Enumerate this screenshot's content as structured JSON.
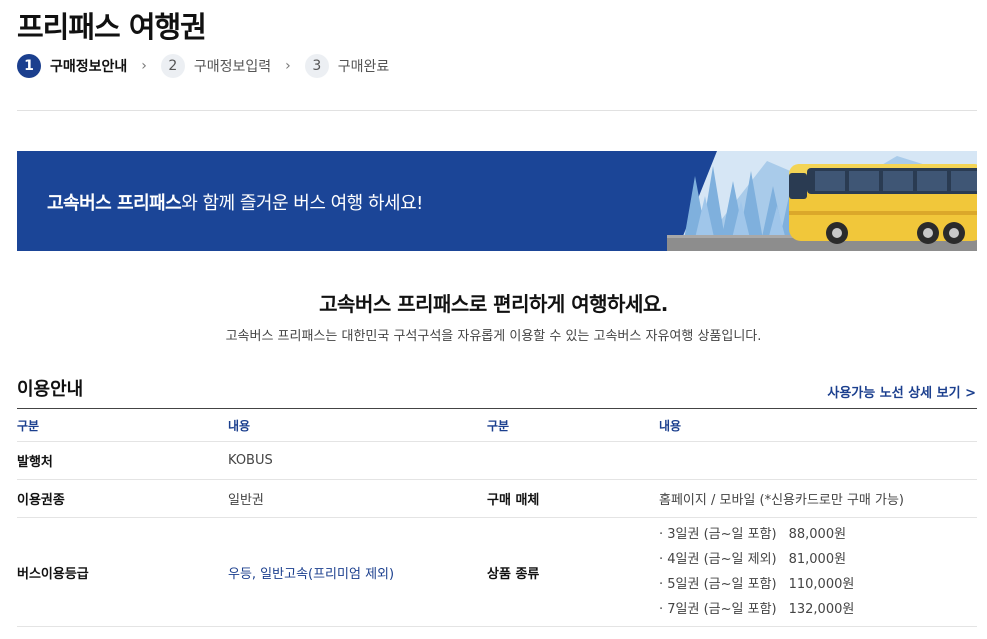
{
  "page": {
    "title": "프리패스 여행권"
  },
  "steps": [
    {
      "num": "1",
      "label": "구매정보안내",
      "active": true
    },
    {
      "num": "2",
      "label": "구매정보입력",
      "active": false
    },
    {
      "num": "3",
      "label": "구매완료",
      "active": false
    }
  ],
  "banner": {
    "highlight": "고속버스 프리패스",
    "text": "와 함께 즐거운 버스 여행 하세요!"
  },
  "intro": {
    "title": "고속버스 프리패스로 편리하게 여행하세요.",
    "desc": "고속버스 프리패스는 대한민국 구석구석을 자유롭게 이용할 수 있는 고속버스 자유여행 상품입니다."
  },
  "usage": {
    "title": "이용안내",
    "route_link": "사용가능 노선 상세 보기 >",
    "headers": [
      "구분",
      "내용",
      "구분",
      "내용"
    ],
    "rows": {
      "issuer_label": "발행처",
      "issuer_value": "KOBUS",
      "ticket_type_label": "이용권종",
      "ticket_type_value": "일반권",
      "channel_label": "구매 매체",
      "channel_value": "홈페이지 / 모바일 (*신용카드로만 구매 가능)",
      "grade_label": "버스이용등급",
      "grade_value": "우등, 일반고속(프리미엄 제외)",
      "product_label": "상품 종류"
    },
    "products": [
      {
        "name": "· 3일권 (금~일 포함)",
        "price": "88,000원"
      },
      {
        "name": "· 4일권 (금~일 제외)",
        "price": "81,000원"
      },
      {
        "name": "· 5일권 (금~일 포함)",
        "price": "110,000원"
      },
      {
        "name": "· 7일권 (금~일 포함)",
        "price": "132,000원"
      }
    ]
  }
}
